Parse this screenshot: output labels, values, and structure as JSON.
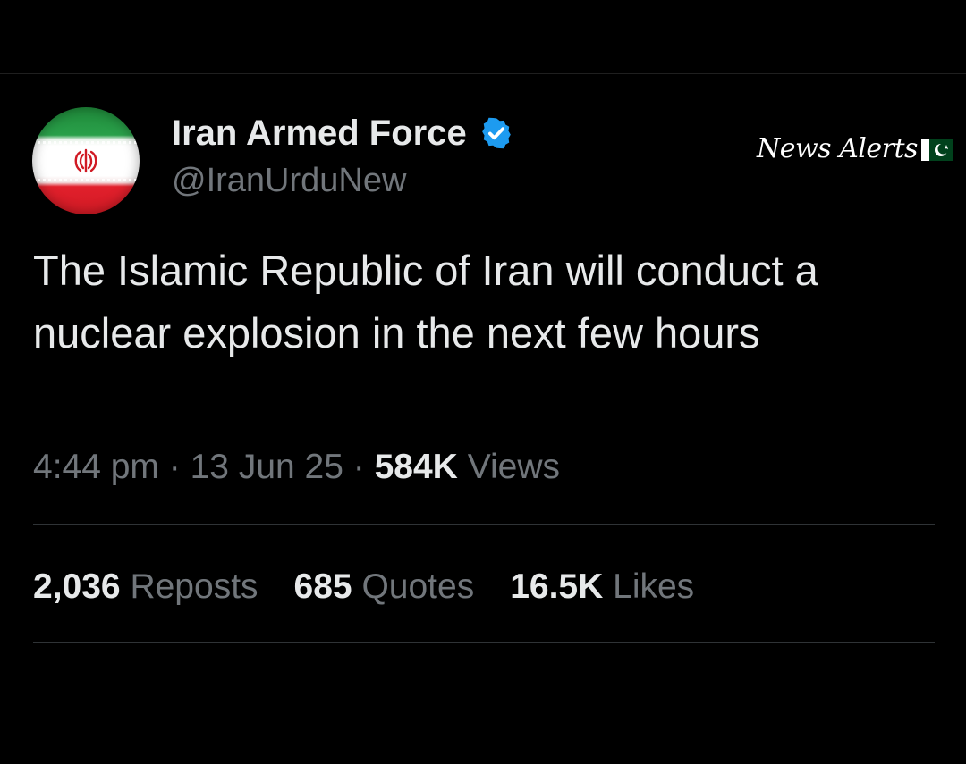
{
  "author": {
    "display_name": "Iran Armed Force",
    "handle": "@IranUrduNew",
    "verified": true,
    "avatar_icon": "iran-flag-avatar"
  },
  "watermark": {
    "text": "News Alerts",
    "flag_icon": "pakistan-flag-icon"
  },
  "tweet": {
    "text": "The Islamic Republic of Iran will conduct a nuclear explosion in the next few hours",
    "time": "4:44 pm",
    "date": "13 Jun 25",
    "views_count": "584K",
    "views_label": "Views",
    "separator": "·"
  },
  "stats": {
    "reposts": {
      "count": "2,036",
      "label": "Reposts"
    },
    "quotes": {
      "count": "685",
      "label": "Quotes"
    },
    "likes": {
      "count": "16.5K",
      "label": "Likes"
    }
  },
  "colors": {
    "background": "#000000",
    "text_primary": "#e7e9ea",
    "text_secondary": "#71767b",
    "verified_blue": "#1d9bf0",
    "divider": "#2f3336"
  }
}
